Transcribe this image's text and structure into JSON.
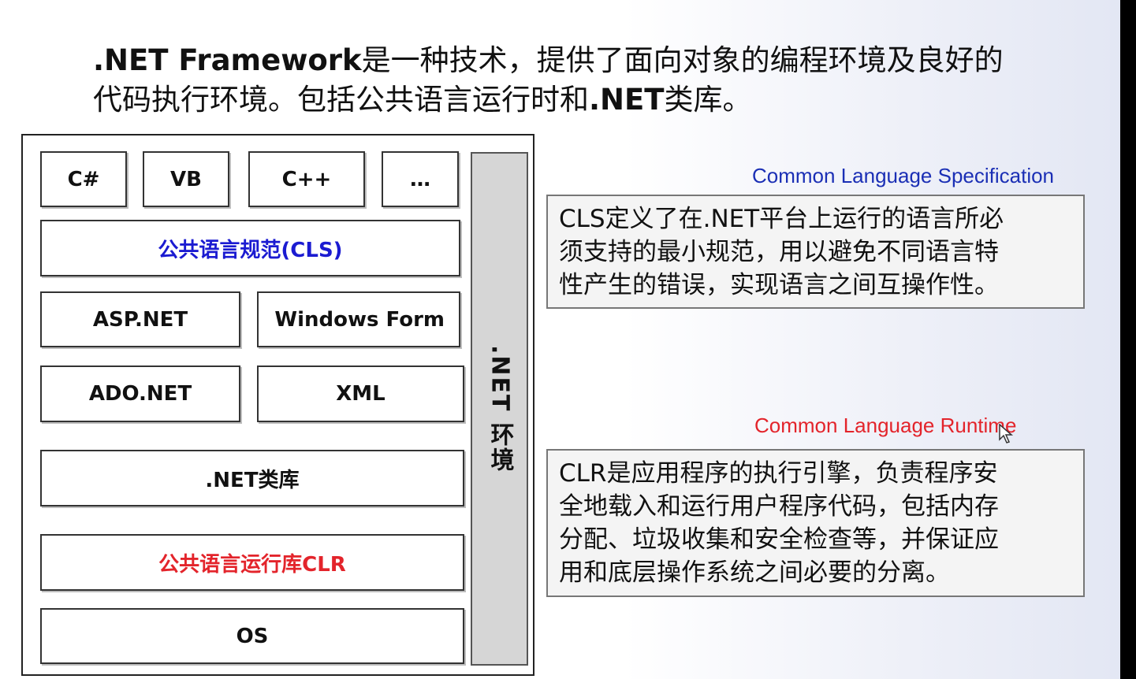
{
  "slide": {
    "title_line1_bold": ".NET Framework",
    "title_line1_rest": "是一种技术，提供了面向对象的编程环境及良好的",
    "title_line2_pre": "代码执行环境。包括公共语言运行时和",
    "title_line2_bold": ".NET",
    "title_line2_post": "类库。"
  },
  "diagram": {
    "languages": [
      "C#",
      "VB",
      "C++",
      "…"
    ],
    "cls": "公共语言规范(CLS)",
    "asp": "ASP.NET",
    "winform": "Windows Form",
    "ado": "ADO.NET",
    "xml": "XML",
    "lib": ".NET类库",
    "clr": "公共语言运行库CLR",
    "os": "OS",
    "env": ".NET 环境"
  },
  "cls_panel": {
    "english": "Common Language Specification",
    "lines": [
      "CLS定义了在.NET平台上运行的语言所必",
      "须支持的最小规范，用以避免不同语言特",
      "性产生的错误，实现语言之间互操作性。"
    ]
  },
  "clr_panel": {
    "english": "Common Language Runtime",
    "lines": [
      "CLR是应用程序的执行引擎，负责程序安",
      "全地载入和运行用户程序代码，包括内存",
      "分配、垃圾收集和安全检查等，并保证应",
      "用和底层操作系统之间必要的分离。"
    ]
  },
  "colors": {
    "blue": "#1b1bd1",
    "red": "#e3242b",
    "env_fill": "#d6d6d6"
  }
}
